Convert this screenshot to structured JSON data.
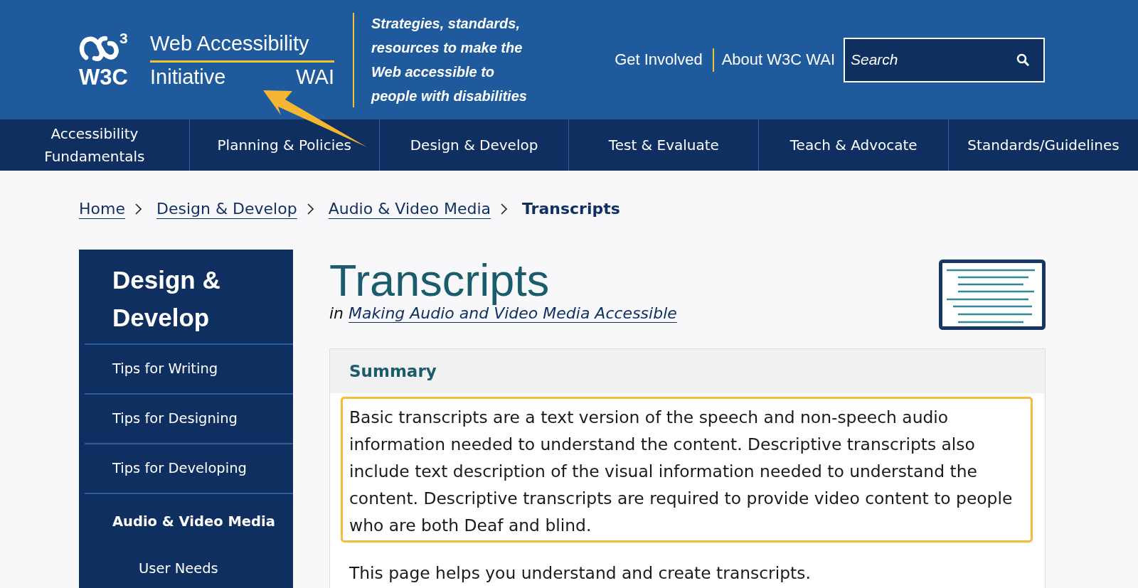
{
  "header": {
    "logo": {
      "mark_superscript": "3",
      "mark": "W3C",
      "title_top": "Web Accessibility",
      "title_bottom": "Initiative",
      "acronym": "WAI"
    },
    "tagline": "Strategies, standards, resources to make the Web accessible to people with disabilities",
    "links": [
      "Get Involved",
      "About W3C WAI"
    ],
    "search": {
      "placeholder": "Search"
    }
  },
  "nav": [
    "Accessibility Fundamentals",
    "Planning & Policies",
    "Design & Develop",
    "Test & Evaluate",
    "Teach & Advocate",
    "Standards/Guidelines"
  ],
  "breadcrumb": [
    {
      "label": "Home",
      "kind": "link"
    },
    {
      "label": "Design & Develop",
      "kind": "link"
    },
    {
      "label": "Audio & Video Media",
      "kind": "link"
    },
    {
      "label": "Transcripts",
      "kind": "current"
    }
  ],
  "sidebar": {
    "title": "Design & Develop",
    "items": [
      {
        "label": "Tips for Writing",
        "selected": false
      },
      {
        "label": "Tips for Designing",
        "selected": false
      },
      {
        "label": "Tips for Developing",
        "selected": false
      },
      {
        "label": "Audio & Video Media",
        "selected": true,
        "children": [
          {
            "label": "User Needs",
            "selected": false
          }
        ]
      }
    ]
  },
  "page": {
    "title": "Transcripts",
    "context_prefix": "in",
    "context_link": "Making Audio and Video Media Accessible"
  },
  "summary": {
    "heading": "Summary",
    "paragraphs": [
      {
        "text": "Basic transcripts are a text version of the speech and non-speech audio information needed to understand the content. Descriptive transcripts also include text description of the visual information needed to understand the content. Descriptive transcripts are required to provide video content to people who are both Deaf and blind.",
        "highlighted": true
      },
      {
        "text": "This page helps you understand and create transcripts.",
        "highlighted": false
      }
    ]
  }
}
